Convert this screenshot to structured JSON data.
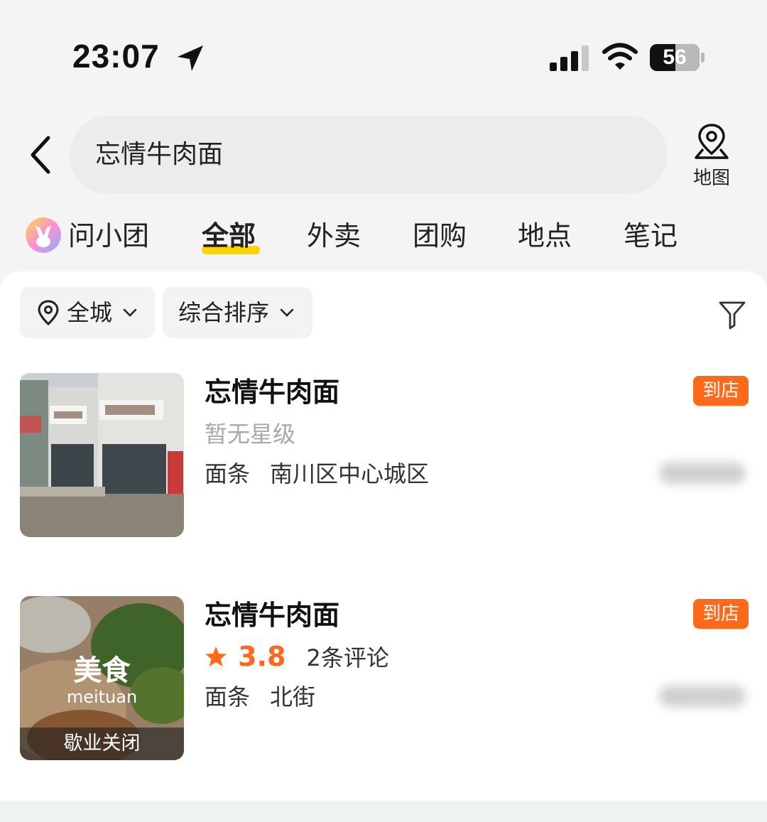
{
  "status_bar": {
    "time": "23:07",
    "battery_level": "56"
  },
  "search": {
    "query": "忘情牛肉面",
    "map_label": "地图"
  },
  "tabs": [
    {
      "label": "问小团"
    },
    {
      "label": "全部",
      "active": true
    },
    {
      "label": "外卖"
    },
    {
      "label": "团购"
    },
    {
      "label": "地点"
    },
    {
      "label": "笔记"
    }
  ],
  "filters": {
    "area": "全城",
    "sort": "综合排序"
  },
  "results": [
    {
      "name": "忘情牛肉面",
      "badge": "到店",
      "rating_text": "暂无星级",
      "category": "面条",
      "district": "南川区中心城区"
    },
    {
      "name": "忘情牛肉面",
      "badge": "到店",
      "score": "3.8",
      "reviews": "2条评论",
      "category": "面条",
      "district": "北街",
      "thumb_title": "美食",
      "thumb_sub": "meituan",
      "status": "歇业关闭"
    }
  ],
  "colors": {
    "accent_orange": "#ff6a1a",
    "tab_underline": "#ffd200",
    "background": "#f4f4f4"
  },
  "icons": [
    "location-arrow-icon",
    "signal-icon",
    "wifi-icon",
    "battery-icon",
    "back-icon",
    "map-pin-icon",
    "location-pin-icon",
    "chevron-down-icon",
    "filter-icon",
    "star-icon"
  ]
}
